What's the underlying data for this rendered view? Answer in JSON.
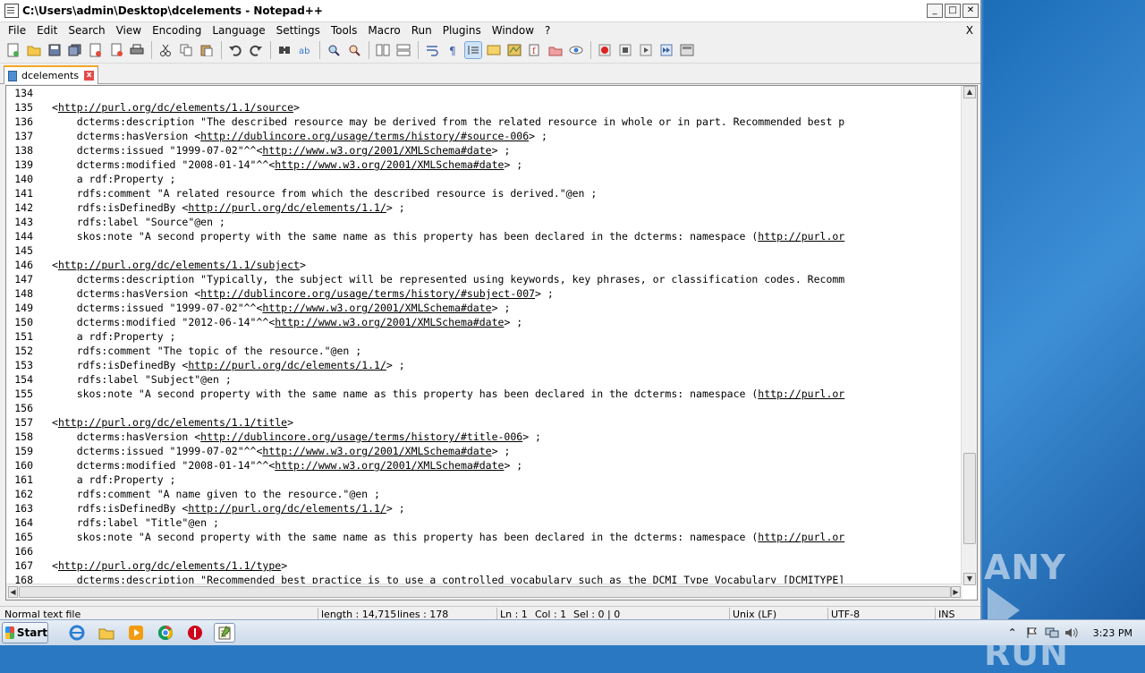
{
  "window": {
    "title": "C:\\Users\\admin\\Desktop\\dcelements - Notepad++",
    "minimize": "_",
    "maximize": "□",
    "close": "✕"
  },
  "menu": [
    "File",
    "Edit",
    "Search",
    "View",
    "Encoding",
    "Language",
    "Settings",
    "Tools",
    "Macro",
    "Run",
    "Plugins",
    "Window",
    "?"
  ],
  "menu_close": "X",
  "tab": {
    "label": "dcelements",
    "close": "x"
  },
  "lines": [
    {
      "n": "134",
      "t": ""
    },
    {
      "n": "135",
      "t": "<<u>http://purl.org/dc/elements/1.1/source</u>>"
    },
    {
      "n": "136",
      "t": "    dcterms:description \"The described resource may be derived from the related resource in whole or in part. Recommended best p"
    },
    {
      "n": "137",
      "t": "    dcterms:hasVersion <<u>http://dublincore.org/usage/terms/history/#source-006</u>> ;"
    },
    {
      "n": "138",
      "t": "    dcterms:issued \"1999-07-02\"^^<<u>http://www.w3.org/2001/XMLSchema#date</u>> ;"
    },
    {
      "n": "139",
      "t": "    dcterms:modified \"2008-01-14\"^^<<u>http://www.w3.org/2001/XMLSchema#date</u>> ;"
    },
    {
      "n": "140",
      "t": "    a rdf:Property ;"
    },
    {
      "n": "141",
      "t": "    rdfs:comment \"A related resource from which the described resource is derived.\"@en ;"
    },
    {
      "n": "142",
      "t": "    rdfs:isDefinedBy <<u>http://purl.org/dc/elements/1.1/</u>> ;"
    },
    {
      "n": "143",
      "t": "    rdfs:label \"Source\"@en ;"
    },
    {
      "n": "144",
      "t": "    skos:note \"A second property with the same name as this property has been declared in the dcterms: namespace (<u>http://purl.or</u>"
    },
    {
      "n": "145",
      "t": ""
    },
    {
      "n": "146",
      "t": "<<u>http://purl.org/dc/elements/1.1/subject</u>>"
    },
    {
      "n": "147",
      "t": "    dcterms:description \"Typically, the subject will be represented using keywords, key phrases, or classification codes. Recomm"
    },
    {
      "n": "148",
      "t": "    dcterms:hasVersion <<u>http://dublincore.org/usage/terms/history/#subject-007</u>> ;"
    },
    {
      "n": "149",
      "t": "    dcterms:issued \"1999-07-02\"^^<<u>http://www.w3.org/2001/XMLSchema#date</u>> ;"
    },
    {
      "n": "150",
      "t": "    dcterms:modified \"2012-06-14\"^^<<u>http://www.w3.org/2001/XMLSchema#date</u>> ;"
    },
    {
      "n": "151",
      "t": "    a rdf:Property ;"
    },
    {
      "n": "152",
      "t": "    rdfs:comment \"The topic of the resource.\"@en ;"
    },
    {
      "n": "153",
      "t": "    rdfs:isDefinedBy <<u>http://purl.org/dc/elements/1.1/</u>> ;"
    },
    {
      "n": "154",
      "t": "    rdfs:label \"Subject\"@en ;"
    },
    {
      "n": "155",
      "t": "    skos:note \"A second property with the same name as this property has been declared in the dcterms: namespace (<u>http://purl.or</u>"
    },
    {
      "n": "156",
      "t": ""
    },
    {
      "n": "157",
      "t": "<<u>http://purl.org/dc/elements/1.1/title</u>>"
    },
    {
      "n": "158",
      "t": "    dcterms:hasVersion <<u>http://dublincore.org/usage/terms/history/#title-006</u>> ;"
    },
    {
      "n": "159",
      "t": "    dcterms:issued \"1999-07-02\"^^<<u>http://www.w3.org/2001/XMLSchema#date</u>> ;"
    },
    {
      "n": "160",
      "t": "    dcterms:modified \"2008-01-14\"^^<<u>http://www.w3.org/2001/XMLSchema#date</u>> ;"
    },
    {
      "n": "161",
      "t": "    a rdf:Property ;"
    },
    {
      "n": "162",
      "t": "    rdfs:comment \"A name given to the resource.\"@en ;"
    },
    {
      "n": "163",
      "t": "    rdfs:isDefinedBy <<u>http://purl.org/dc/elements/1.1/</u>> ;"
    },
    {
      "n": "164",
      "t": "    rdfs:label \"Title\"@en ;"
    },
    {
      "n": "165",
      "t": "    skos:note \"A second property with the same name as this property has been declared in the dcterms: namespace (<u>http://purl.or</u>"
    },
    {
      "n": "166",
      "t": ""
    },
    {
      "n": "167",
      "t": "<<u>http://purl.org/dc/elements/1.1/type</u>>"
    },
    {
      "n": "168",
      "t": "    dcterms:description \"Recommended best practice is to use a controlled vocabulary such as the DCMI Type Vocabulary [DCMITYPE]"
    }
  ],
  "status": {
    "file_type": "Normal text file",
    "length": "length : 14,715",
    "lines": "lines : 178",
    "ln": "Ln : 1",
    "col": "Col : 1",
    "sel": "Sel : 0 | 0",
    "eol": "Unix (LF)",
    "encoding": "UTF-8",
    "mode": "INS"
  },
  "taskbar": {
    "start": "Start",
    "clock": "3:23 PM"
  },
  "watermark": {
    "left": "ANY",
    "right": "RUN"
  }
}
